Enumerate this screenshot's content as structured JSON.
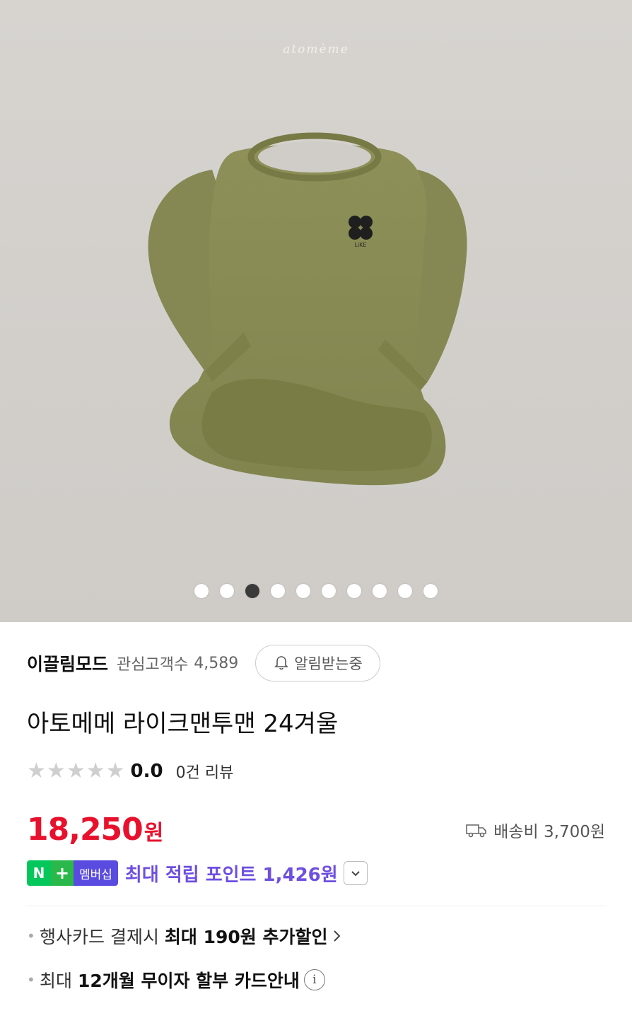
{
  "product_image": {
    "watermark": "atomème",
    "logo_text": "LiKE",
    "carousel": {
      "total": 10,
      "active_index": 2
    }
  },
  "store": {
    "name": "이끌림모드",
    "follower_label": "관심고객수",
    "follower_count": "4,589",
    "alarm_label": "알림받는중"
  },
  "product": {
    "title": "아토메메 라이크맨투맨 24겨울",
    "rating": "0.0",
    "review_count": "0건 리뷰",
    "price": "18,250",
    "price_unit": "원",
    "shipping": "배송비 3,700원"
  },
  "membership": {
    "badge_n": "N",
    "badge_plus": "+",
    "badge_label": "멤버십",
    "points_text": "최대 적립 포인트 1,426원"
  },
  "benefits": {
    "card_discount": {
      "prefix": "행사카드 결제시",
      "highlight": "최대 190원 추가할인"
    },
    "installment": {
      "prefix": "최대",
      "highlight": "12개월 무이자 할부 카드안내"
    }
  },
  "colors": {
    "price_red": "#e8112d",
    "points_purple": "#6e4fe0",
    "naver_green": "#03c75a",
    "garment_olive": "#8b8e57"
  }
}
